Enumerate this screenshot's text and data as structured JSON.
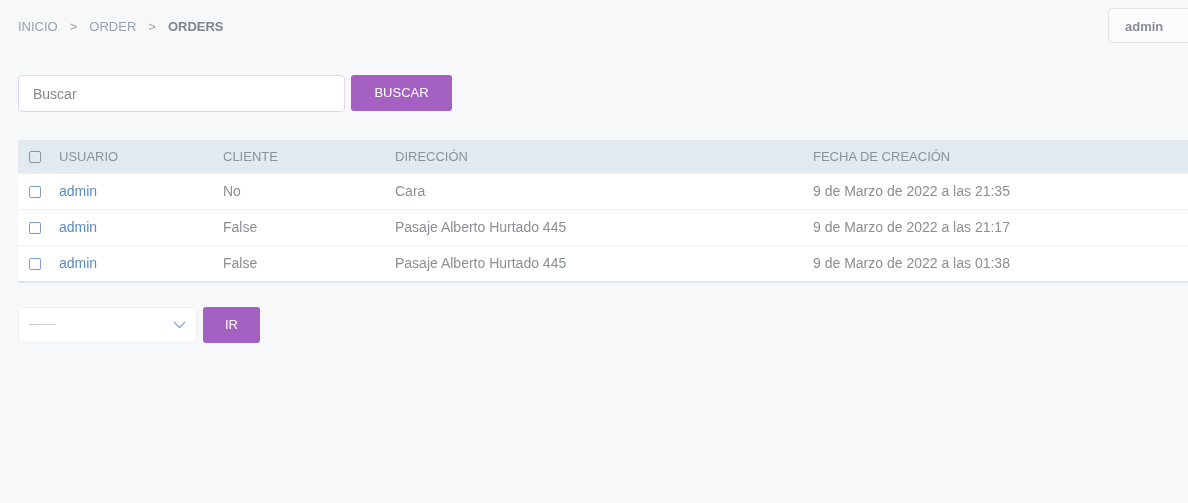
{
  "breadcrumb": [
    {
      "label": "INICIO",
      "current": false
    },
    {
      "label": "ORDER",
      "current": false
    },
    {
      "label": "ORDERS",
      "current": true
    }
  ],
  "separator": ">",
  "user_menu": {
    "label": "admin"
  },
  "search": {
    "placeholder": "Buscar",
    "button": "BUSCAR"
  },
  "table": {
    "select_all": {
      "checked": false
    },
    "columns": [
      "USUARIO",
      "CLIENTE",
      "DIRECCIÓN",
      "FECHA DE CREACIÓN"
    ],
    "rows": [
      {
        "checked": false,
        "cells": [
          "admin",
          "No",
          "Cara",
          "9 de Marzo de 2022 a las 21:35"
        ]
      },
      {
        "checked": false,
        "cells": [
          "admin",
          "False",
          "Pasaje Alberto Hurtado 445",
          "9 de Marzo de 2022 a las 21:17"
        ]
      },
      {
        "checked": false,
        "cells": [
          "admin",
          "False",
          "Pasaje Alberto Hurtado 445",
          "9 de Marzo de 2022 a las 01:38"
        ]
      }
    ]
  },
  "action": {
    "value": "---------",
    "button": "IR"
  }
}
